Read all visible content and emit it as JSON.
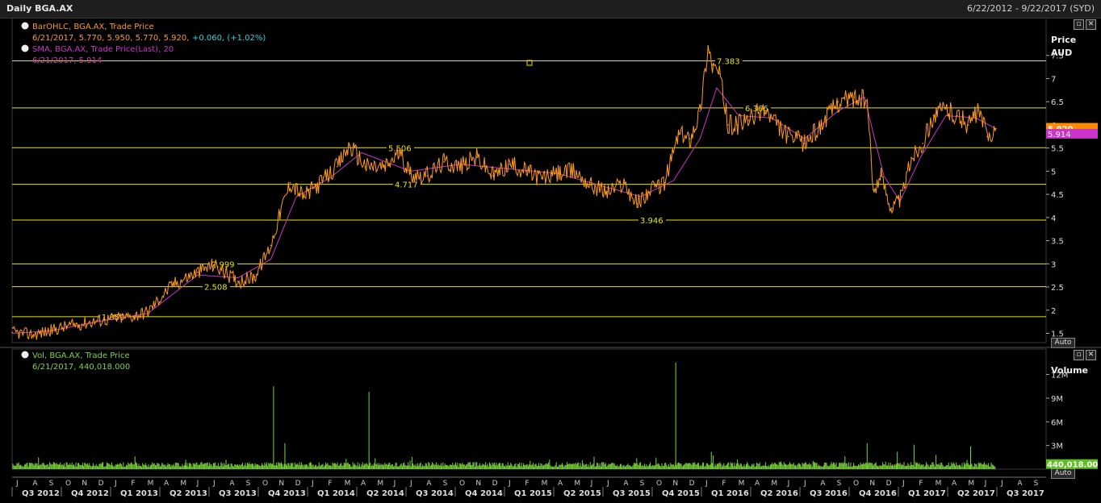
{
  "window": {
    "title": "Daily BGA.AX",
    "date_range": "6/22/2012 - 9/22/2017 (SYD)"
  },
  "price_panel": {
    "legend": [
      {
        "icon": "clock-icon",
        "name": "BarOHLC, BGA.AX, Trade Price",
        "values": "6/21/2017, 5.770, 5.950, 5.770, 5.920,",
        "change": "+0.060, (+1.02%)",
        "color": "#ff9a1a",
        "change_color": "#34d4d4"
      },
      {
        "icon": "clock-icon",
        "name": "SMA, BGA.AX, Trade Price(Last),  20",
        "values": "6/21/2017, 5.914",
        "change": "",
        "color": "#cc33cc",
        "change_color": "#cc33cc"
      }
    ],
    "axis_title": "Price",
    "axis_unit": "AUD",
    "last_price_tag": "5.920",
    "sma_tag": "5.914",
    "auto_label": "Auto",
    "y_ticks": [
      "7.5",
      "7",
      "6.5",
      "6",
      "5.5",
      "5",
      "4.5",
      "4",
      "3.5",
      "3",
      "2.5",
      "2",
      "1.5"
    ]
  },
  "volume_panel": {
    "legend": {
      "icon": "clock-icon",
      "name": "Vol, BGA.AX, Trade Price",
      "values": "6/21/2017, 440,018.000",
      "color": "#7dd63a"
    },
    "axis_title": "Volume",
    "last_volume_tag": "440,018.00",
    "auto_label": "Auto",
    "y_ticks": [
      "12M",
      "9M",
      "6M",
      "3M"
    ]
  },
  "x_axis": {
    "months": [
      "J",
      "A",
      "S",
      "O",
      "N",
      "D",
      "J",
      "F",
      "M",
      "A",
      "M",
      "J",
      "J",
      "A",
      "S",
      "O",
      "N",
      "D",
      "J",
      "F",
      "M",
      "A",
      "M",
      "J",
      "J",
      "A",
      "S",
      "O",
      "N",
      "D",
      "J",
      "F",
      "M",
      "A",
      "M",
      "J",
      "J",
      "A",
      "S",
      "O",
      "N",
      "D",
      "J",
      "F",
      "M",
      "A",
      "M",
      "J",
      "J",
      "A",
      "S",
      "O",
      "N",
      "D",
      "J",
      "F",
      "M",
      "A",
      "M",
      "J",
      "J",
      "A",
      "S"
    ],
    "quarters": [
      "Q3 2012",
      "Q4 2012",
      "Q1 2013",
      "Q2 2013",
      "Q3 2013",
      "Q4 2013",
      "Q1 2014",
      "Q2 2014",
      "Q3 2014",
      "Q4 2014",
      "Q1 2015",
      "Q2 2015",
      "Q3 2015",
      "Q4 2015",
      "Q1 2016",
      "Q2 2016",
      "Q3 2016",
      "Q4 2016",
      "Q1 2017",
      "Q2 2017",
      "Q3 2017"
    ]
  },
  "chart_data": {
    "type": "line",
    "title": "Daily BGA.AX",
    "ylabel": "Price AUD",
    "ylim": [
      1.3,
      8.0
    ],
    "volume_ylim": [
      0,
      14000000
    ],
    "horizontal_levels": [
      7.383,
      6.366,
      5.506,
      4.717,
      3.946,
      2.999,
      2.508,
      1.859
    ],
    "series": [
      {
        "name": "BarOHLC, BGA.AX, Trade Price",
        "color": "#ff9a1a",
        "x": [
          "2012-06-22",
          "2012-08-01",
          "2012-10-01",
          "2012-12-01",
          "2013-02-01",
          "2013-03-01",
          "2013-04-15",
          "2013-06-01",
          "2013-07-01",
          "2013-08-15",
          "2013-09-15",
          "2013-10-15",
          "2013-11-01",
          "2013-11-20",
          "2013-12-15",
          "2014-01-15",
          "2014-02-15",
          "2014-03-10",
          "2014-04-10",
          "2014-05-15",
          "2014-06-10",
          "2014-07-01",
          "2014-08-01",
          "2014-09-01",
          "2014-10-01",
          "2014-11-01",
          "2014-12-01",
          "2015-01-01",
          "2015-02-01",
          "2015-03-01",
          "2015-04-01",
          "2015-05-01",
          "2015-06-01",
          "2015-07-01",
          "2015-08-01",
          "2015-08-25",
          "2015-09-15",
          "2015-10-15",
          "2015-11-10",
          "2015-12-01",
          "2015-12-20",
          "2016-01-04",
          "2016-01-12",
          "2016-01-25",
          "2016-02-10",
          "2016-02-28",
          "2016-03-20",
          "2016-04-15",
          "2016-05-10",
          "2016-06-01",
          "2016-07-01",
          "2016-08-01",
          "2016-09-01",
          "2016-10-01",
          "2016-10-25",
          "2016-11-05",
          "2016-11-20",
          "2016-12-10",
          "2016-12-28",
          "2017-01-15",
          "2017-02-05",
          "2017-02-25",
          "2017-03-20",
          "2017-04-10",
          "2017-05-01",
          "2017-05-20",
          "2017-06-05",
          "2017-06-21"
        ],
        "values": [
          1.52,
          1.47,
          1.65,
          1.78,
          1.87,
          1.97,
          2.55,
          2.82,
          2.98,
          2.62,
          2.72,
          3.4,
          4.1,
          4.75,
          4.45,
          4.75,
          5.1,
          5.55,
          5.1,
          5.08,
          5.4,
          4.95,
          4.9,
          5.2,
          5.1,
          5.3,
          4.9,
          5.15,
          5.0,
          4.85,
          4.95,
          5.0,
          4.7,
          4.55,
          4.75,
          4.3,
          4.55,
          4.75,
          5.8,
          5.7,
          6.3,
          7.7,
          7.3,
          7.1,
          6.0,
          6.0,
          6.1,
          6.35,
          6.0,
          5.75,
          5.6,
          6.0,
          6.5,
          6.6,
          6.5,
          4.6,
          4.9,
          4.2,
          4.45,
          5.3,
          5.6,
          6.2,
          6.35,
          6.2,
          6.0,
          6.3,
          5.75,
          5.92
        ]
      },
      {
        "name": "SMA, BGA.AX, Trade Price(Last),  20",
        "color": "#cc33cc",
        "x": [
          "2012-06-22",
          "2012-09-01",
          "2012-12-01",
          "2013-03-01",
          "2013-06-01",
          "2013-08-15",
          "2013-10-15",
          "2013-12-01",
          "2014-02-01",
          "2014-04-01",
          "2014-07-01",
          "2014-10-01",
          "2015-01-01",
          "2015-04-01",
          "2015-07-01",
          "2015-09-01",
          "2015-11-01",
          "2015-12-20",
          "2016-01-20",
          "2016-03-01",
          "2016-05-01",
          "2016-07-01",
          "2016-09-01",
          "2016-10-20",
          "2016-11-25",
          "2016-12-25",
          "2017-02-01",
          "2017-03-20",
          "2017-05-15",
          "2017-06-21"
        ],
        "values": [
          1.5,
          1.55,
          1.76,
          1.93,
          2.76,
          2.7,
          3.1,
          4.45,
          4.85,
          5.4,
          5.0,
          5.15,
          5.05,
          4.95,
          4.65,
          4.45,
          4.8,
          5.7,
          6.8,
          6.2,
          6.15,
          5.7,
          6.3,
          6.6,
          4.9,
          4.35,
          5.3,
          6.2,
          6.15,
          5.914
        ]
      }
    ],
    "volume": {
      "name": "Vol, BGA.AX, Trade Price",
      "color": "#7dd63a",
      "spikes": [
        {
          "x": "2013-10-20",
          "value": 10500000
        },
        {
          "x": "2013-11-10",
          "value": 3300000
        },
        {
          "x": "2014-04-15",
          "value": 9800000
        },
        {
          "x": "2015-11-05",
          "value": 13500000
        },
        {
          "x": "2016-10-25",
          "value": 3300000
        },
        {
          "x": "2016-12-20",
          "value": 2200000
        },
        {
          "x": "2017-01-20",
          "value": 3100000
        },
        {
          "x": "2017-05-05",
          "value": 2900000
        },
        {
          "x": "2012-08-10",
          "value": 1500000
        },
        {
          "x": "2013-05-10",
          "value": 1200000
        },
        {
          "x": "2016-01-10",
          "value": 2200000
        }
      ],
      "last": 440018
    }
  }
}
